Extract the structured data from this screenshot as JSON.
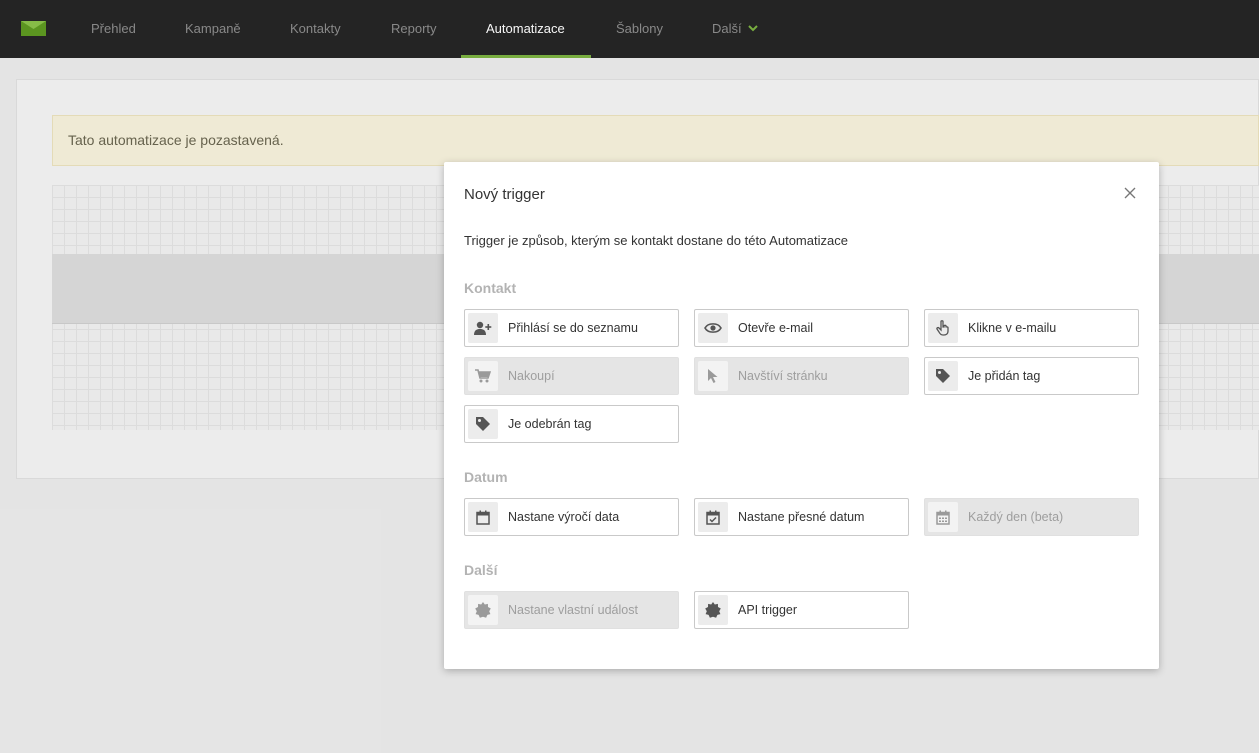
{
  "nav": {
    "items": [
      {
        "label": "Přehled"
      },
      {
        "label": "Kampaně"
      },
      {
        "label": "Kontakty"
      },
      {
        "label": "Reporty"
      },
      {
        "label": "Automatizace"
      },
      {
        "label": "Šablony"
      },
      {
        "label": "Další"
      }
    ],
    "active": "Automatizace",
    "accent_color": "#7cb342"
  },
  "page": {
    "alert_text": "Tato automatizace je pozastavená."
  },
  "modal": {
    "title": "Nový trigger",
    "description": "Trigger je způsob, kterým se kontakt dostane do této Automatizace",
    "sections": [
      {
        "title": "Kontakt",
        "options": [
          {
            "label": "Přihlásí se do seznamu",
            "icon": "user-plus-icon",
            "enabled": true
          },
          {
            "label": "Otevře e-mail",
            "icon": "eye-icon",
            "enabled": true
          },
          {
            "label": "Klikne v e-mailu",
            "icon": "hand-pointer-icon",
            "enabled": true
          },
          {
            "label": "Nakoupí",
            "icon": "shopping-cart-icon",
            "enabled": false
          },
          {
            "label": "Navštíví stránku",
            "icon": "mouse-pointer-icon",
            "enabled": false
          },
          {
            "label": "Je přidán tag",
            "icon": "tag-icon",
            "enabled": true
          },
          {
            "label": "Je odebrán tag",
            "icon": "tag-icon",
            "enabled": true
          }
        ]
      },
      {
        "title": "Datum",
        "options": [
          {
            "label": "Nastane výročí data",
            "icon": "calendar-icon",
            "enabled": true
          },
          {
            "label": "Nastane přesné datum",
            "icon": "calendar-check-icon",
            "enabled": true
          },
          {
            "label": "Každý den (beta)",
            "icon": "calendar-grid-icon",
            "enabled": false
          }
        ]
      },
      {
        "title": "Další",
        "options": [
          {
            "label": "Nastane vlastní událost",
            "icon": "certificate-icon",
            "enabled": false
          },
          {
            "label": "API trigger",
            "icon": "certificate-icon",
            "enabled": true
          }
        ]
      }
    ]
  }
}
